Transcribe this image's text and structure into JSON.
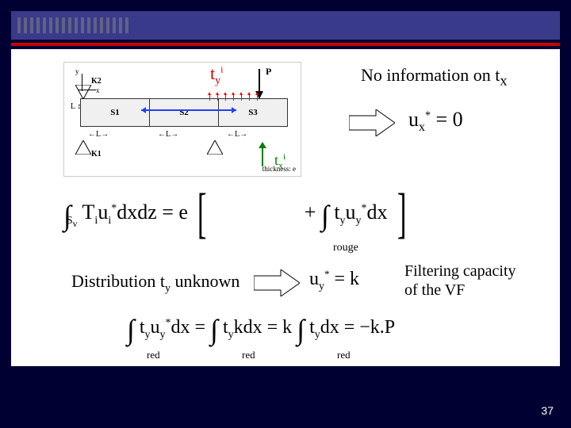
{
  "header": {},
  "diagram": {
    "axis_y": "y",
    "axis_x": "x",
    "segments": [
      "S1",
      "S2",
      "S3"
    ],
    "dim_side": "L",
    "dim_bottom": "L",
    "k_top": "K2",
    "k_bottom": "K1",
    "thickness": "thickness: e",
    "load": "P"
  },
  "ty": {
    "base": "t",
    "sub": "y",
    "sup": "i"
  },
  "tx": {
    "base": "t",
    "sub": "x",
    "sup": "i"
  },
  "noinfo": "No information on t",
  "noinfo_sub": "x",
  "ux0": {
    "lhs_base": "u",
    "lhs_sub": "x",
    "lhs_sup": "*",
    "rhs": "= 0"
  },
  "eq1": {
    "lhs_pre": "",
    "int1_sub": "S",
    "int1_sup": "",
    "body1": "T",
    "body1_sub": "i",
    "body1b": "u",
    "body1b_sub": "i",
    "body1b_sup": "*",
    "body1_tail": "dxdz = e",
    "plus": "+ ",
    "int2_sub": "rouge",
    "body2": "t",
    "body2_sub": "y",
    "body2b": "u",
    "body2b_sub": "y",
    "body2b_sup": "*",
    "body2_tail": "dx",
    "rouge_label": "rouge"
  },
  "dist": {
    "pre": "Distribution t",
    "sub": "y",
    "post": " unknown"
  },
  "uyk": {
    "base": "u",
    "sub": "y",
    "sup": "*",
    "rhs": "= k"
  },
  "filter": {
    "l1": "Filtering capacity",
    "l2": "of the VF"
  },
  "eq2": {
    "p1a": "t",
    "p1a_sub": "y",
    "p1b": "u",
    "p1b_sub": "y",
    "p1b_sup": "*",
    "p1_tail": "dx = ",
    "p2a": "t",
    "p2a_sub": "y",
    "p2_tail": "kdx = k",
    "p3a": "t",
    "p3a_sub": "y",
    "p3_tail": "dx = −k.P",
    "red_label": "red"
  },
  "page": "37"
}
